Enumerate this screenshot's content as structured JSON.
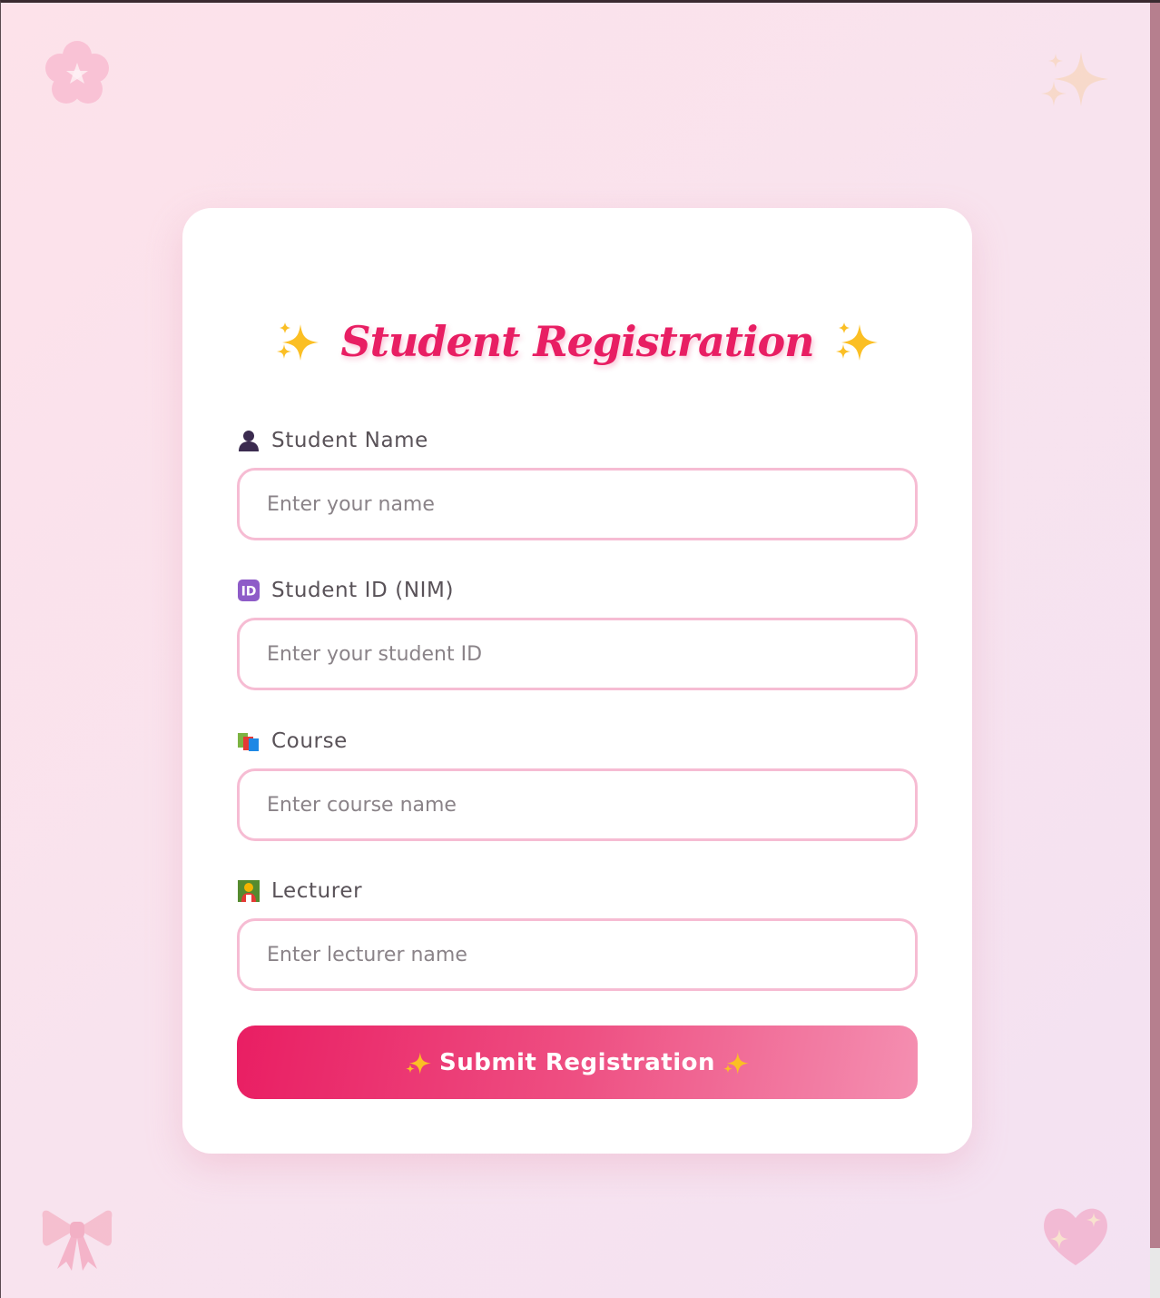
{
  "title": "Student Registration",
  "form": {
    "fields": [
      {
        "label": "Student Name",
        "placeholder": "Enter your name",
        "icon": "bust-silhouette-icon"
      },
      {
        "label": "Student ID (NIM)",
        "placeholder": "Enter your student ID",
        "icon": "id-badge-icon"
      },
      {
        "label": "Course",
        "placeholder": "Enter course name",
        "icon": "books-icon"
      },
      {
        "label": "Lecturer",
        "placeholder": "Enter lecturer name",
        "icon": "teacher-icon"
      }
    ],
    "submit_label": "Submit Registration"
  },
  "decorations": [
    "cherry-blossom-icon",
    "sparkles-icon",
    "ribbon-bow-icon",
    "sparkling-heart-icon"
  ],
  "colors": {
    "accent": "#e81e63",
    "input_border": "#f6bcd3",
    "card": "#ffffff"
  }
}
